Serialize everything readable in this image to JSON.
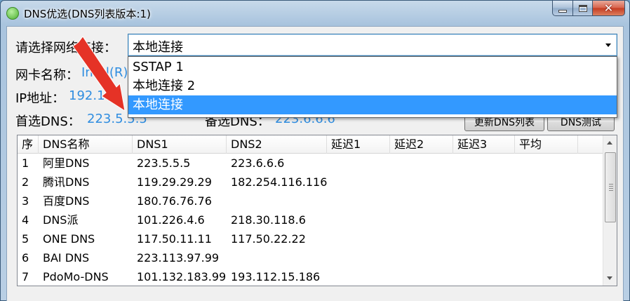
{
  "window": {
    "title": "DNS优选(DNS列表版本:1)",
    "icon": "green-circle-icon"
  },
  "form": {
    "connection_label": "请选择网络连接：",
    "connection_selected": "本地连接",
    "nic_label": "网卡名称：",
    "nic_value": "Intel(R)",
    "ip_label": "IP地址：",
    "ip_value": "192.168",
    "primary_dns_label": "首选DNS：",
    "primary_dns_value": "223.5.5.5",
    "secondary_dns_label": "备选DNS：",
    "secondary_dns_value": "223.6.6.6"
  },
  "dropdown": {
    "options": [
      "SSTAP 1",
      "本地连接 2",
      "本地连接"
    ],
    "selected_index": 2
  },
  "buttons": {
    "update_list": "更新DNS列表",
    "test_dns": "DNS测试"
  },
  "table": {
    "columns": [
      "序",
      "DNS名称",
      "DNS1",
      "DNS2",
      "延迟1",
      "延迟2",
      "延迟3",
      "平均"
    ],
    "rows": [
      [
        "1",
        "阿里DNS",
        "223.5.5.5",
        "223.6.6.6",
        "",
        "",
        "",
        ""
      ],
      [
        "2",
        "腾讯DNS",
        "119.29.29.29",
        "182.254.116.116",
        "",
        "",
        "",
        ""
      ],
      [
        "3",
        "百度DNS",
        "180.76.76.76",
        "",
        "",
        "",
        "",
        ""
      ],
      [
        "4",
        "DNS派",
        "101.226.4.6",
        "218.30.118.6",
        "",
        "",
        "",
        ""
      ],
      [
        "5",
        "ONE DNS",
        "117.50.11.11",
        "117.50.22.22",
        "",
        "",
        "",
        ""
      ],
      [
        "6",
        "BAI DNS",
        "223.113.97.99",
        "",
        "",
        "",
        "",
        ""
      ],
      [
        "7",
        "PdoMo-DNS",
        "101.132.183.99",
        "193.112.15.186",
        "",
        "",
        "",
        ""
      ]
    ]
  },
  "colors": {
    "value_blue": "#2f8de0",
    "selection_blue": "#3399ff",
    "annotation_red": "#e53226"
  }
}
